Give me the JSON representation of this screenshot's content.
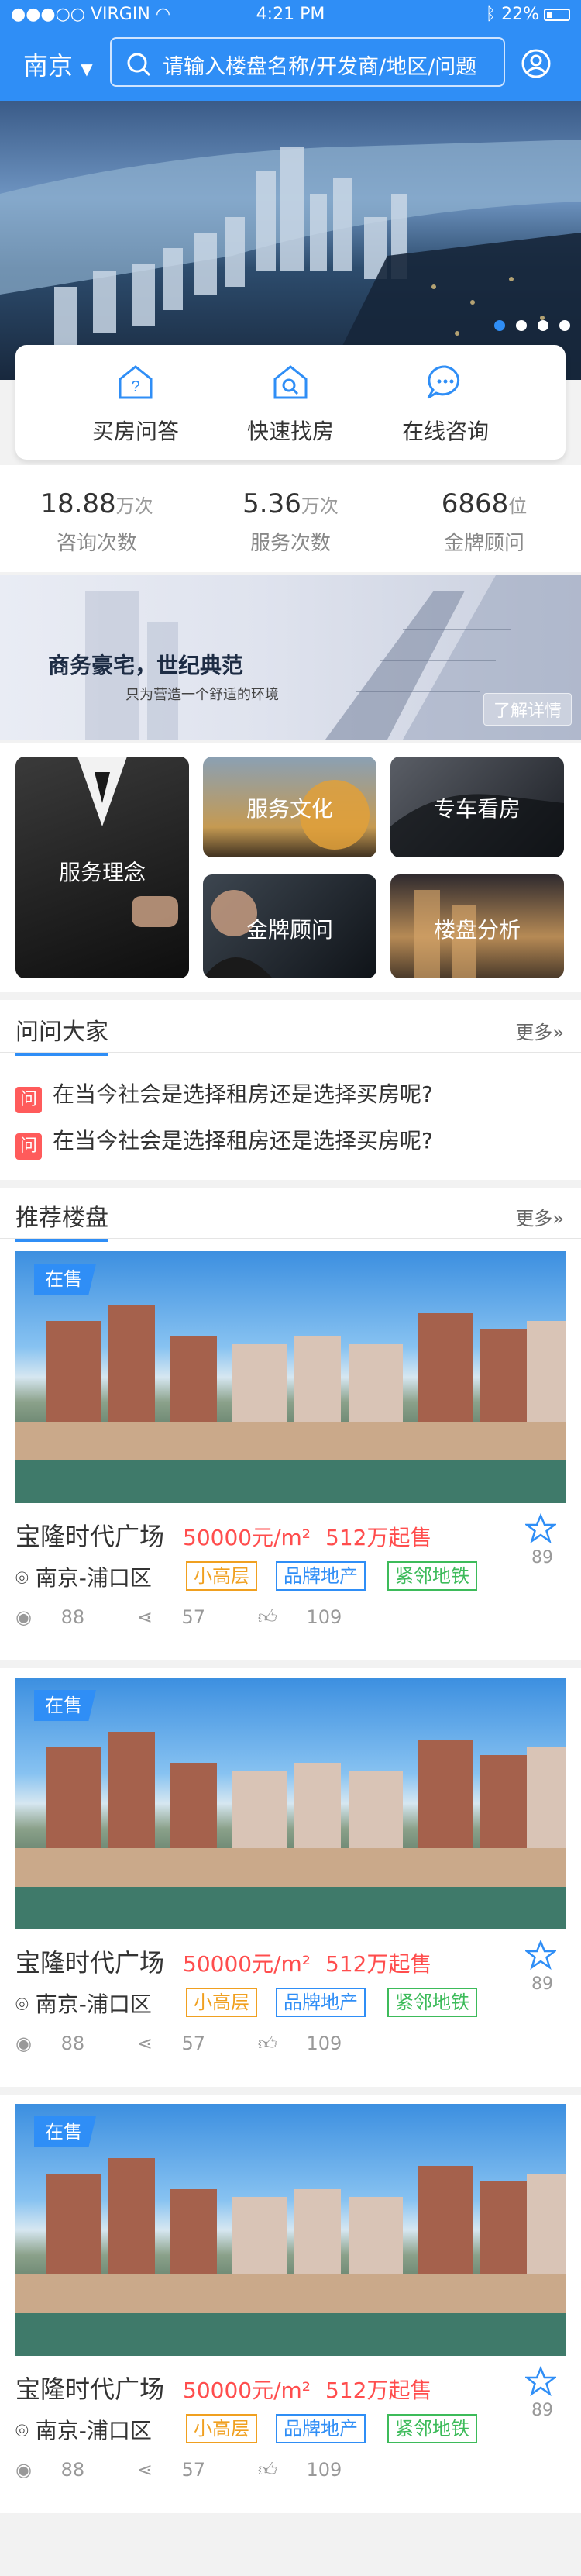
{
  "status_bar": {
    "carrier": "VIRGIN",
    "time": "4:21 PM",
    "battery": "22%"
  },
  "header": {
    "city": "南京",
    "search_placeholder": "请输入楼盘名称/开发商/地区/问题"
  },
  "quick_links": [
    {
      "label": "买房问答",
      "icon": "question-house-icon"
    },
    {
      "label": "快速找房",
      "icon": "search-house-icon"
    },
    {
      "label": "在线咨询",
      "icon": "chat-icon"
    }
  ],
  "stats": [
    {
      "value": "18.88",
      "unit": "万次",
      "label": "咨询次数"
    },
    {
      "value": "5.36",
      "unit": "万次",
      "label": "服务次数"
    },
    {
      "value": "6868",
      "unit": "位",
      "label": "金牌顾问"
    }
  ],
  "promo": {
    "title": "商务豪宅，世纪典范",
    "subtitle": "只为营造一个舒适的环境",
    "button": "了解详情"
  },
  "service_tiles": [
    "服务理念",
    "服务文化",
    "专车看房",
    "金牌顾问",
    "楼盘分析"
  ],
  "ask_section": {
    "title": "问问大家",
    "more": "更多",
    "badge": "问",
    "questions": [
      "在当今社会是选择租房还是选择买房呢?",
      "在当今社会是选择租房还是选择买房呢?"
    ]
  },
  "recommend_section": {
    "title": "推荐楼盘",
    "more": "更多"
  },
  "listings": [
    {
      "status": "在售",
      "name": "宝隆时代广场",
      "price": "50000元/m²",
      "start_price": "512万起售",
      "favorites": "89",
      "location": "南京-浦口区",
      "tags": [
        "小高层",
        "品牌地产",
        "紧邻地铁"
      ],
      "views": "88",
      "shares": "57",
      "likes": "109"
    },
    {
      "status": "在售",
      "name": "宝隆时代广场",
      "price": "50000元/m²",
      "start_price": "512万起售",
      "favorites": "89",
      "location": "南京-浦口区",
      "tags": [
        "小高层",
        "品牌地产",
        "紧邻地铁"
      ],
      "views": "88",
      "shares": "57",
      "likes": "109"
    },
    {
      "status": "在售",
      "name": "宝隆时代广场",
      "price": "50000元/m²",
      "start_price": "512万起售",
      "favorites": "89",
      "location": "南京-浦口区",
      "tags": [
        "小高层",
        "品牌地产",
        "紧邻地铁"
      ],
      "views": "88",
      "shares": "57",
      "likes": "109"
    }
  ],
  "colors": {
    "primary": "#2f8ef6",
    "price": "#ff4d4d",
    "tag_orange": "#f0a020",
    "tag_blue": "#2f8ef6",
    "tag_green": "#3dbb5a"
  }
}
